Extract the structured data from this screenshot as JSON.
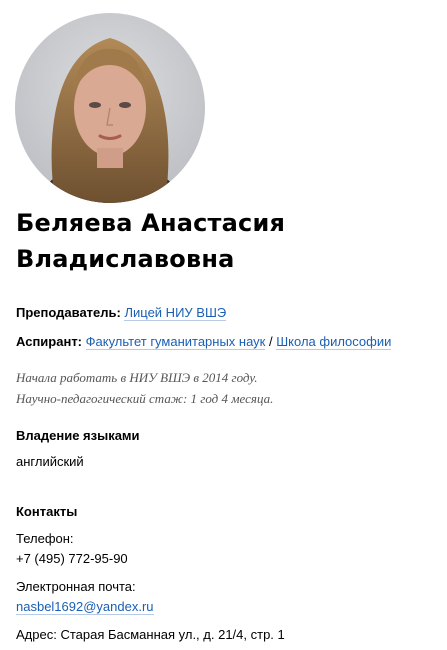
{
  "profile": {
    "name_line1": "Беляева Анастасия",
    "name_line2": "Владиславовна"
  },
  "roles": {
    "teacher_label": "Преподаватель:",
    "teacher_link": "Лицей НИУ ВШЭ",
    "postgrad_label": "Аспирант:",
    "postgrad_link1": "Факультет гуманитарных наук",
    "separator": "/",
    "postgrad_link2": "Школа философии"
  },
  "experience": {
    "line1": "Начала работать в НИУ ВШЭ в 2014 году.",
    "line2": "Научно-педагогический стаж: 1 год 4 месяца."
  },
  "languages": {
    "title": "Владение языками",
    "value": "английский"
  },
  "contacts": {
    "title": "Контакты",
    "phone_label": "Телефон:",
    "phone_value": "+7 (495) 772-95-90",
    "email_label": "Электронная почта:",
    "email_value": "nasbel1692@yandex.ru",
    "address": "Адрес: Старая Басманная ул., д. 21/4, стр. 1"
  },
  "colors": {
    "link": "#1a5fb4",
    "note": "#555555"
  },
  "icons": {
    "avatar": "profile-photo"
  }
}
